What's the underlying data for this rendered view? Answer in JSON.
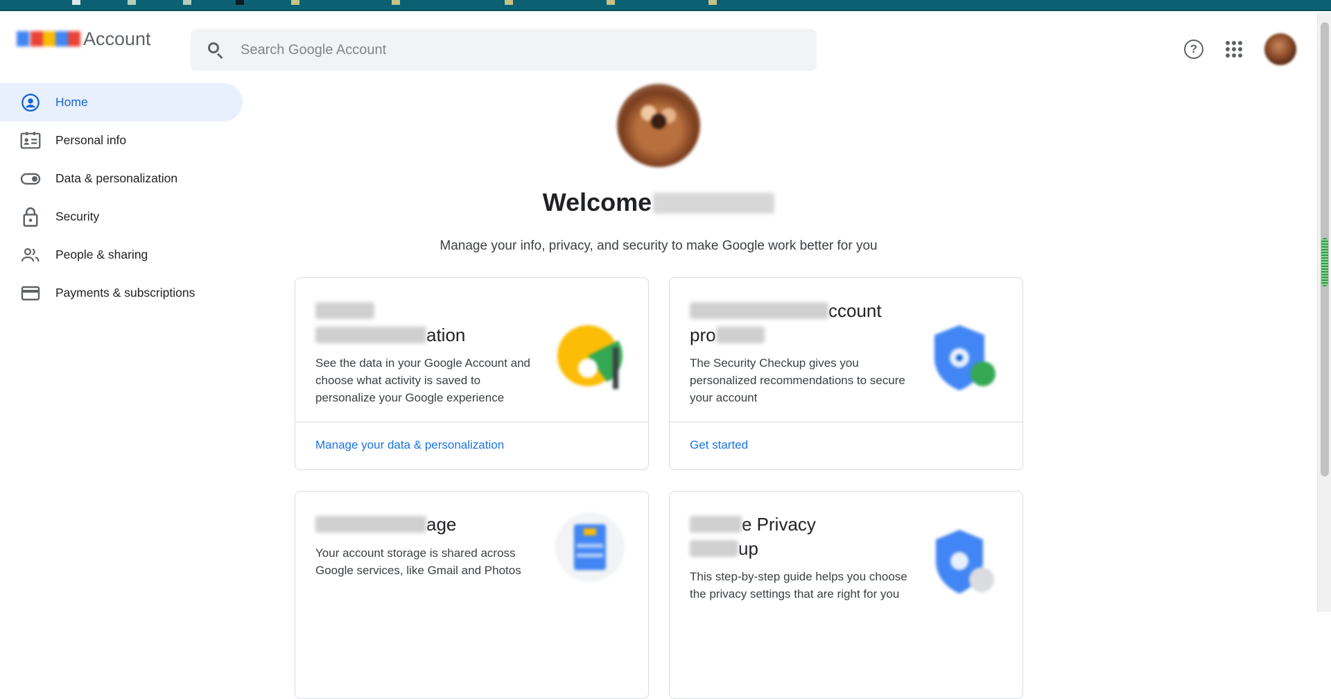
{
  "header": {
    "brand_text": "Account",
    "search_placeholder": "Search Google Account",
    "help_glyph": "?"
  },
  "sidebar": {
    "items": [
      {
        "label": "Home",
        "icon": "account-circle-icon",
        "active": true
      },
      {
        "label": "Personal info",
        "icon": "id-card-icon",
        "active": false
      },
      {
        "label": "Data & personalization",
        "icon": "toggle-icon",
        "active": false
      },
      {
        "label": "Security",
        "icon": "lock-icon",
        "active": false
      },
      {
        "label": "People & sharing",
        "icon": "people-icon",
        "active": false
      },
      {
        "label": "Payments & subscriptions",
        "icon": "credit-card-icon",
        "active": false
      }
    ]
  },
  "main": {
    "welcome_prefix": "Welcome",
    "subtitle": "Manage your info, privacy, and security to make Google work better for you",
    "cards": [
      {
        "title_visible": "ation",
        "description": "See the data in your Google Account and choose what activity is saved to personalize your Google experience",
        "link": "Manage your data & personalization",
        "icon": "privacy-personalization-icon"
      },
      {
        "title_visible_1": "ccount",
        "title_visible_2": "pro",
        "description": "The Security Checkup gives you personalized recommendations to secure your account",
        "link": "Get started",
        "icon": "security-shield-icon"
      },
      {
        "title_visible": "age",
        "description": "Your account storage is shared across Google services, like Gmail and Photos",
        "icon": "storage-icon"
      },
      {
        "title_visible_1": "e Privacy",
        "title_visible_2": "up",
        "description": "This step-by-step guide helps you choose the privacy settings that are right for you",
        "icon": "privacy-checkup-icon"
      }
    ]
  },
  "colors": {
    "accent": "#1a73e8",
    "active_nav_bg": "#e8f0fe",
    "top_strip": "#0b6173"
  }
}
